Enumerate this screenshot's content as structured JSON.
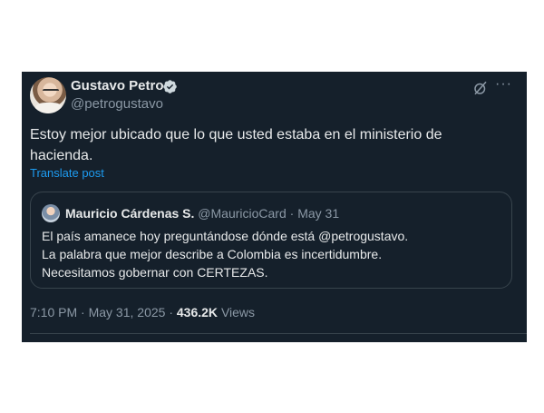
{
  "tweet": {
    "author_name": "Gustavo Petro",
    "author_handle": "@petrogustavo",
    "text_line1": "Estoy mejor ubicado que lo que usted estaba en el ministerio de",
    "text_line2": "hacienda.",
    "translate_label": "Translate post",
    "time": "7:10 PM",
    "dot": "·",
    "date": "May 31, 2025",
    "views_count": "436.2K",
    "views_label": "Views",
    "more_glyph": "···"
  },
  "quote": {
    "author_name": "Mauricio Cárdenas S.",
    "author_handle": "@MauricioCard",
    "dot": "·",
    "date": "May 31",
    "line1": "El país amanece hoy preguntándose dónde está @petrogustavo.",
    "line2": "La palabra que mejor describe a Colombia es incertidumbre.",
    "line3": "Necesitamos gobernar con CERTEZAS."
  },
  "colors": {
    "background": "#15202b",
    "text": "#e7e9ea",
    "secondary": "#8b98a5",
    "accent": "#1d9bf0",
    "border": "#38444d"
  },
  "icons": {
    "verified": "verified-badge-icon",
    "grok": "grok-icon",
    "more": "more-icon"
  }
}
